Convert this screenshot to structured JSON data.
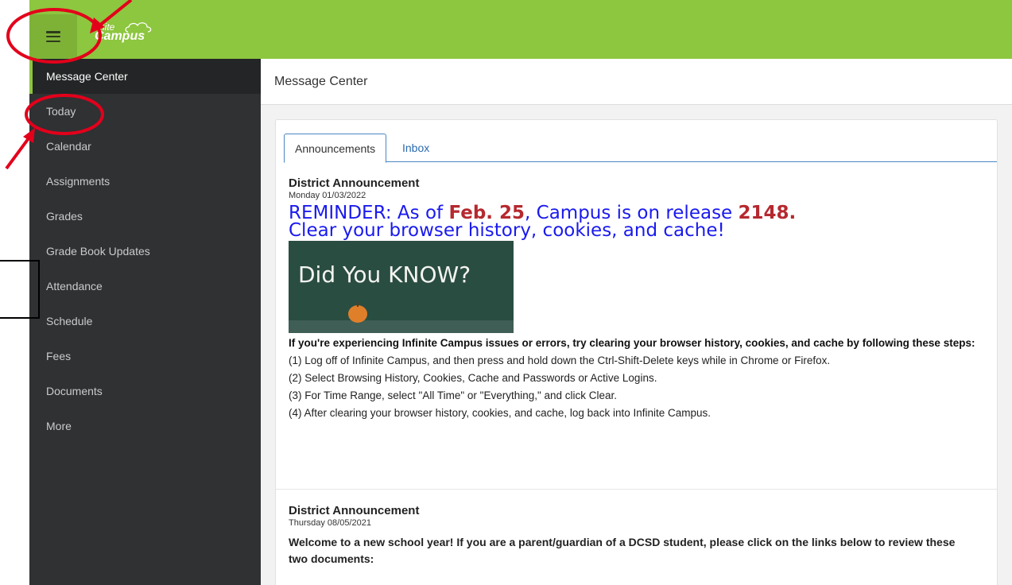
{
  "app": {
    "logo_line1": "finite",
    "logo_line2": "Campus"
  },
  "sidebar": {
    "items": [
      {
        "label": "Message Center",
        "active": true
      },
      {
        "label": "Today"
      },
      {
        "label": "Calendar"
      },
      {
        "label": "Assignments"
      },
      {
        "label": "Grades"
      },
      {
        "label": "Grade Book Updates"
      },
      {
        "label": "Attendance"
      },
      {
        "label": "Schedule"
      },
      {
        "label": "Fees"
      },
      {
        "label": "Documents"
      },
      {
        "label": "More"
      }
    ]
  },
  "main": {
    "page_title": "Message Center",
    "tabs": [
      {
        "label": "Announcements",
        "active": true
      },
      {
        "label": "Inbox"
      }
    ],
    "announcements": [
      {
        "title": "District Announcement",
        "date": "Monday 01/03/2022",
        "headline_part1": "REMINDER: As of ",
        "headline_highlight1": "Feb. 25",
        "headline_part2": ", Campus is on release ",
        "headline_highlight2": "2148.",
        "headline_line2": "Clear your browser history, cookies, and cache!",
        "image_text": "Did You KNOW?",
        "lead": "If you're experiencing Infinite Campus issues or errors, try clearing your browser history, cookies, and cache by following these steps:",
        "steps": [
          "(1) Log off of Infinite Campus, and then press and hold down the Ctrl-Shift-Delete keys while in Chrome or Firefox.",
          "(2) Select Browsing History, Cookies, Cache and Passwords or Active Logins.",
          "(3) For Time Range, select \"All Time\" or \"Everything,\" and click Clear.",
          "(4) After clearing your browser history, cookies, and cache, log back into Infinite Campus."
        ]
      },
      {
        "title": "District Announcement",
        "date": "Thursday 08/05/2021",
        "body": "Welcome to a new school year!  If you are a parent/guardian of a DCSD student, please click on the links below to review these two documents:"
      }
    ]
  },
  "colors": {
    "topbar": "#8dc63f",
    "sidebar": "#2f3133",
    "link": "#2a6ab0",
    "headline_blue": "#1a1aef",
    "headline_red": "#b5292f",
    "annotation_red": "#e3001b"
  }
}
